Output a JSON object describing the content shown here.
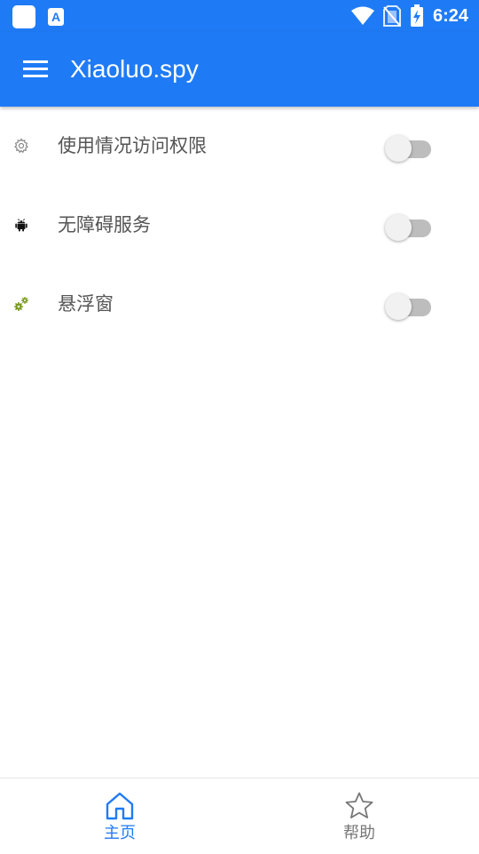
{
  "status_bar": {
    "time": "6:24",
    "icons": [
      "app-square-icon",
      "font-a-icon",
      "wifi-icon",
      "no-sim-icon",
      "battery-charging-icon"
    ],
    "notification_glyph": "A"
  },
  "app_bar": {
    "title": "Xiaoluo.spy",
    "menu_icon": "hamburger-menu-icon"
  },
  "permissions": [
    {
      "label": "使用情况访问权限",
      "icon": "gear-outline-icon",
      "enabled": false
    },
    {
      "label": "无障碍服务",
      "icon": "android-icon",
      "enabled": false
    },
    {
      "label": "悬浮窗",
      "icon": "gears-icon",
      "enabled": false
    }
  ],
  "bottom_nav": {
    "items": [
      {
        "label": "主页",
        "icon": "home-icon",
        "active": true
      },
      {
        "label": "帮助",
        "icon": "star-icon",
        "active": false
      }
    ]
  },
  "colors": {
    "primary": "#1f7bf5",
    "switch_track_off": "#bdbdbd",
    "switch_thumb_off": "#f1f1f1",
    "label_text": "#555555",
    "nav_inactive": "#777777"
  }
}
